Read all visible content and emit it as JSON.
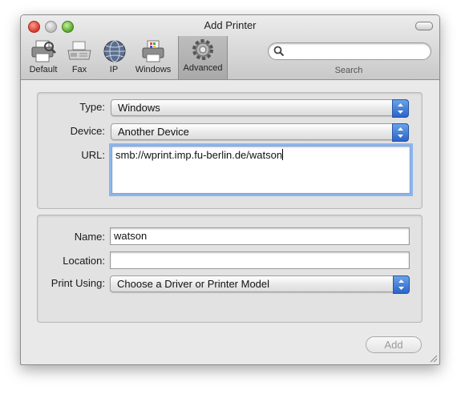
{
  "window": {
    "title": "Add Printer"
  },
  "toolbar": {
    "items": [
      {
        "label": "Default",
        "icon": "default-printer-icon"
      },
      {
        "label": "Fax",
        "icon": "fax-icon"
      },
      {
        "label": "IP",
        "icon": "globe-icon"
      },
      {
        "label": "Windows",
        "icon": "windows-printer-icon"
      },
      {
        "label": "Advanced",
        "icon": "gear-icon",
        "selected": true
      }
    ],
    "search": {
      "label": "Search",
      "value": "",
      "placeholder": ""
    }
  },
  "connection": {
    "type_label": "Type:",
    "type_value": "Windows",
    "device_label": "Device:",
    "device_value": "Another Device",
    "url_label": "URL:",
    "url_value": "smb://wprint.imp.fu-berlin.de/watson"
  },
  "details": {
    "name_label": "Name:",
    "name_value": "watson",
    "location_label": "Location:",
    "location_value": "",
    "print_using_label": "Print Using:",
    "print_using_value": "Choose a Driver or Printer Model"
  },
  "actions": {
    "add_label": "Add",
    "add_enabled": false
  },
  "colors": {
    "accent": "#3b78d8",
    "focus_ring": "#8db5ec",
    "window_bg": "#e9e9e9"
  }
}
